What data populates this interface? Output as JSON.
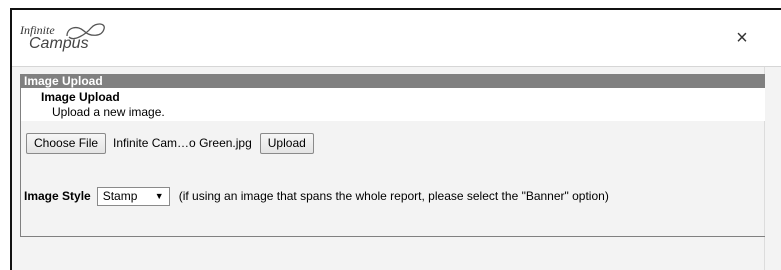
{
  "header": {
    "logo_line1": "Infinite",
    "logo_line2": "Campus",
    "close_label": "×"
  },
  "panel": {
    "title": "Image Upload",
    "heading": "Image Upload",
    "description": "Upload a new image."
  },
  "file": {
    "choose_label": "Choose File",
    "filename": "Infinite Cam…o Green.jpg",
    "upload_label": "Upload"
  },
  "style": {
    "label": "Image Style",
    "selected": "Stamp",
    "arrow": "▼",
    "hint": "(if using an image that spans the whole report, please select the \"Banner\" option)"
  }
}
